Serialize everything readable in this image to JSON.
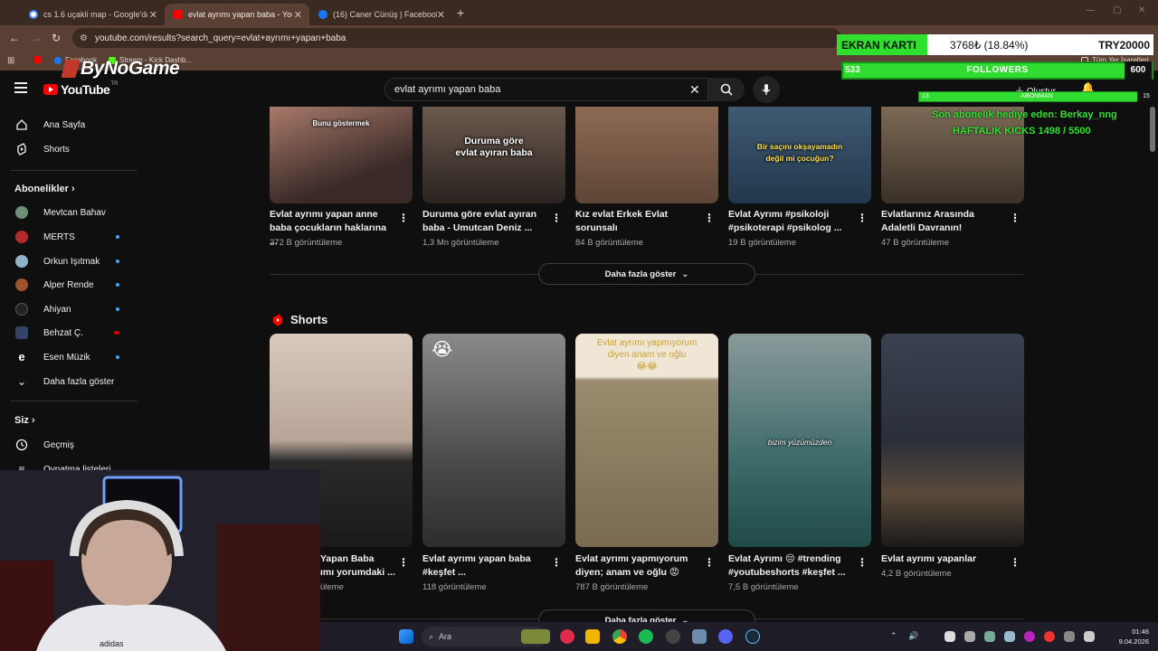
{
  "browser": {
    "tabs": [
      {
        "label": "cs 1.6 uçakli map - Google'da A",
        "color": "#4285f4"
      },
      {
        "label": "evlat ayrımı yapan baba - YouTu",
        "color": "#ff0000"
      },
      {
        "label": "(16) Caner Cünüş | Facebook",
        "color": "#1877f2"
      }
    ],
    "new_tab": "+",
    "url": "youtube.com/results?search_query=evlat+ayrımı+yapan+baba",
    "bookmarks": [
      {
        "label": "Facebook",
        "color": "#1877f2"
      },
      {
        "label": "Stream - Kick Dashb...",
        "color": "#53fc18"
      }
    ],
    "all_bookmarks": "Tüm Yer İşaretleri"
  },
  "youtube": {
    "logo_text": "YouTube",
    "logo_region": "TR",
    "search_value": "evlat ayrımı yapan baba",
    "create_label": "Oluştur"
  },
  "sidebar": {
    "main": [
      {
        "label": "Ana Sayfa",
        "icon": "home-icon"
      },
      {
        "label": "Shorts",
        "icon": "shorts-icon"
      }
    ],
    "subs_header": "Abonelikler",
    "subs": [
      {
        "label": "Mevtcan Bahav",
        "color": "#6d8f7a",
        "dot": false
      },
      {
        "label": "MERTS",
        "color": "#b52a2a",
        "dot": true
      },
      {
        "label": "Orkun Işıtmak",
        "color": "#8fb3c7",
        "dot": true
      },
      {
        "label": "Alper Rende",
        "color": "#a0522d",
        "dot": true
      },
      {
        "label": "Ahiyan",
        "color": "#222222",
        "dot": true
      },
      {
        "label": "Behzat Ç.",
        "color": "#334466",
        "dot": true
      },
      {
        "label": "Esen Müzik",
        "color": "#ffffff",
        "dot": true
      }
    ],
    "show_more": "Daha fazla göster",
    "you_header": "Siz",
    "you": [
      {
        "label": "Geçmiş",
        "icon": "history-icon"
      },
      {
        "label": "Oynatma listeleri",
        "icon": "playlist-icon"
      }
    ]
  },
  "videos": [
    {
      "title1": "Evlat ayrımı yapan anne",
      "title2": "baba çocukların haklarına ...",
      "views": "272 B görüntüleme",
      "thumb_text": "Bunu göstermek",
      "bg": "#5b3a35"
    },
    {
      "title1": "Duruma göre evlat ayıran",
      "title2": "baba - Umutcan Deniz ...",
      "views": "1,3 Mn görüntüleme",
      "thumb_text": "Duruma göre\nevlat ayıran baba",
      "bg": "#3d342e"
    },
    {
      "title1": "Kız evlat Erkek Evlat",
      "title2": "sorunsalı",
      "views": "84 B görüntüleme",
      "thumb_text": "",
      "bg": "#7a5a45"
    },
    {
      "title1": "Evlat Ayrımı #psikoloji",
      "title2": "#psikoterapi #psikolog ...",
      "views": "19 B görüntüleme",
      "thumb_text": "Bir saçını okşayamadın\ndeğil mi çocuğun?",
      "bg": "#2d4660"
    },
    {
      "title1": "Evlatlarınız Arasında",
      "title2": "Adaletli Davranın!",
      "views": "47 B görüntüleme",
      "thumb_text": "",
      "bg": "#4a3f35"
    }
  ],
  "show_more_videos": "Daha fazla göster",
  "shorts_header": "Shorts",
  "shorts": [
    {
      "title1": "Yapan Baba",
      "title2": "ımı yorumdaki ...",
      "views": "üleme",
      "thumb_text": "",
      "bg": "#c9b8ad"
    },
    {
      "title1": "Evlat ayrımı yapan baba",
      "title2": "#keşfet ...",
      "views": "118 görüntüleme",
      "thumb_text": "😭",
      "bg": "#6a6a6a"
    },
    {
      "title1": "Evlat ayrımı yapmıyorum",
      "title2": "diyen; anam ve oğlu 😡",
      "views": "787 B görüntüleme",
      "thumb_text": "Evlat ayrımı yapmıyorum\ndiyen anam ve oğlu\n😂😂",
      "bg": "#8a7a5e"
    },
    {
      "title1": "Evlat Ayrımı 😔 #trending",
      "title2": "#youtubeshorts #keşfet ...",
      "views": "7,5 B görüntüleme",
      "thumb_text": "bizim yüzümüzden",
      "bg": "#2d5a5a"
    },
    {
      "title1": "Evlat ayrımı yapanlar",
      "title2": "",
      "views": "4,2 B görüntüleme",
      "thumb_text": "",
      "bg": "#2a2f3d"
    }
  ],
  "show_more_shorts": "Daha fazla göster",
  "overlay": {
    "ekran_label": "EKRAN KARTI",
    "ekran_value": "3768₺ (18.84%)",
    "ekran_target": "TRY20000",
    "ekran_progress": 0.1884,
    "followers_current": "533",
    "followers_label": "FOLLOWERS",
    "followers_goal": "600",
    "abone_current": "13",
    "abone_label": "ABONMAN",
    "abone_goal": "15",
    "sub_gift": "Son abonelik hediye eden: Berkay_nng",
    "kicks": "HAFTALIK KICKS 1498 / 5500",
    "brand": "ByNoGame"
  },
  "taskbar": {
    "search_placeholder": "Ara",
    "time": "01:46",
    "date": "9.04.2026"
  }
}
